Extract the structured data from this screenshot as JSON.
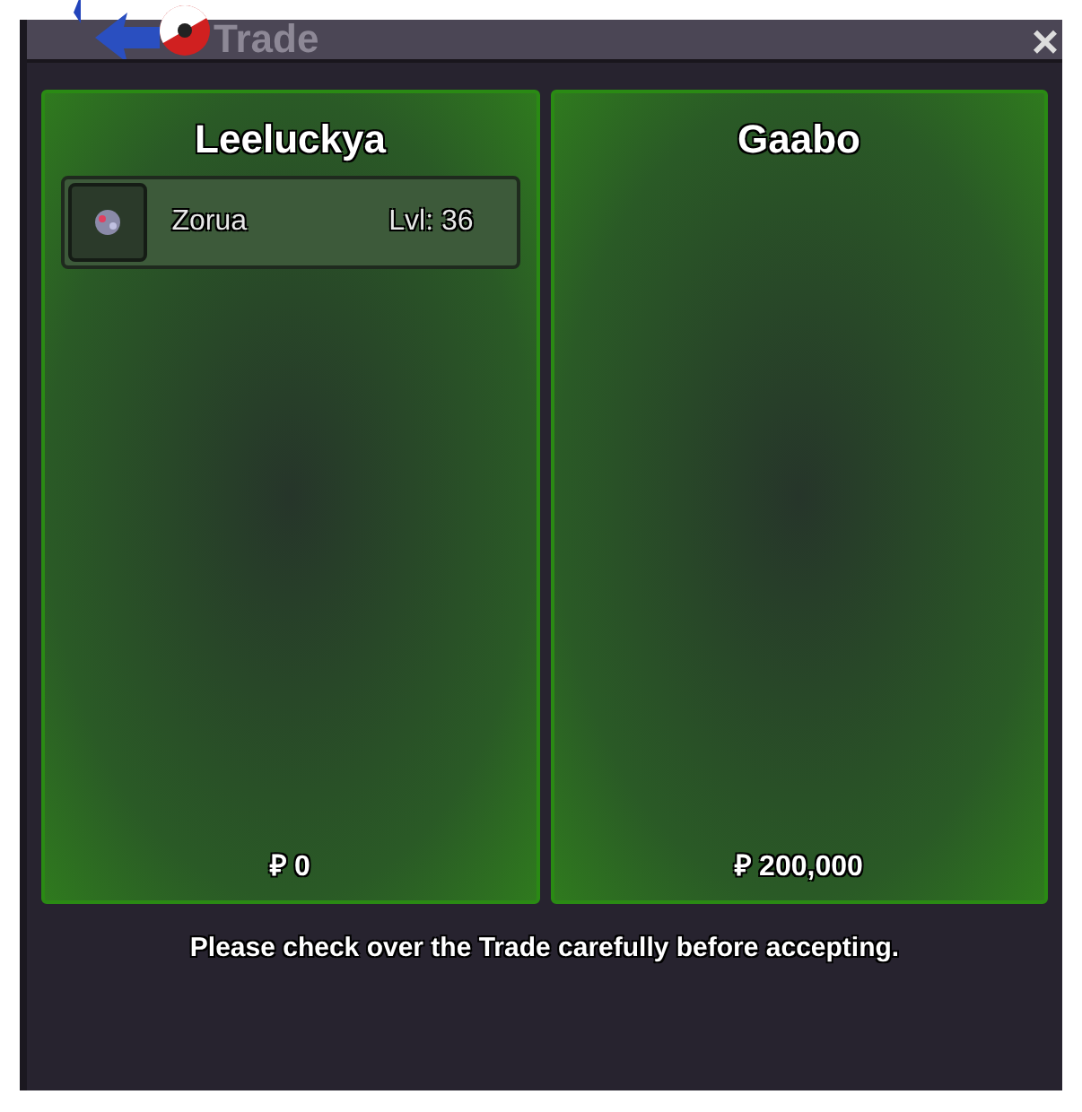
{
  "window": {
    "title": "Trade",
    "close": "×"
  },
  "panels": [
    {
      "name": "Leeluckya",
      "pokemon": [
        {
          "name": "Zorua",
          "level": "Lvl: 36"
        }
      ],
      "money": "₽ 0"
    },
    {
      "name": "Gaabo",
      "money": "₽ 200,000"
    }
  ],
  "message": "Please check over the Trade carefully before accepting."
}
